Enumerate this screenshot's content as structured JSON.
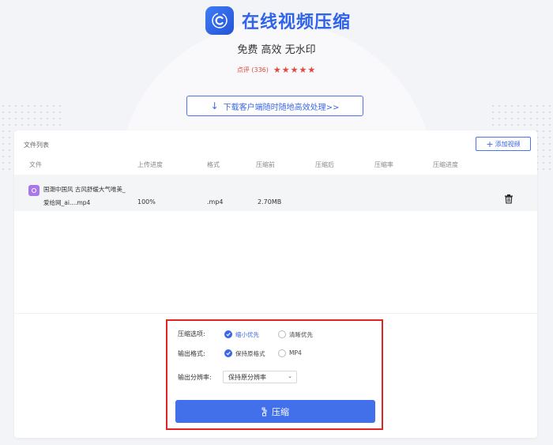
{
  "header": {
    "app_title": "在线视频压缩",
    "subtitle": "免费 高效 无水印",
    "rating_text": "点评 (336)",
    "stars": "★★★★★",
    "download_label": "下载客户端随时随地高效处理>>"
  },
  "file_list": {
    "title": "文件列表",
    "add_button": "添加视频",
    "columns": [
      "文件",
      "上传进度",
      "格式",
      "压缩前",
      "压缩后",
      "压缩率",
      "压缩进度"
    ],
    "rows": [
      {
        "name_line1": "国潮中国风 古风舒缓大气唯美_",
        "name_line2": "爱给网_ai....mp4",
        "upload_progress": "100%",
        "format": ".mp4",
        "size_before": "2.70MB",
        "size_after": "",
        "ratio": "",
        "progress": ""
      }
    ]
  },
  "options": {
    "compress_label": "压缩选项:",
    "compress_opt1": "缩小优先",
    "compress_opt2": "清晰优先",
    "format_label": "输出格式:",
    "format_opt1": "保持原格式",
    "format_opt2": "MP4",
    "resolution_label": "输出分辨率:",
    "resolution_value": "保持原分辨率",
    "compress_button": "压缩"
  },
  "colors": {
    "accent": "#4170ea",
    "highlight_border": "#e02424",
    "star": "#e8453c"
  }
}
